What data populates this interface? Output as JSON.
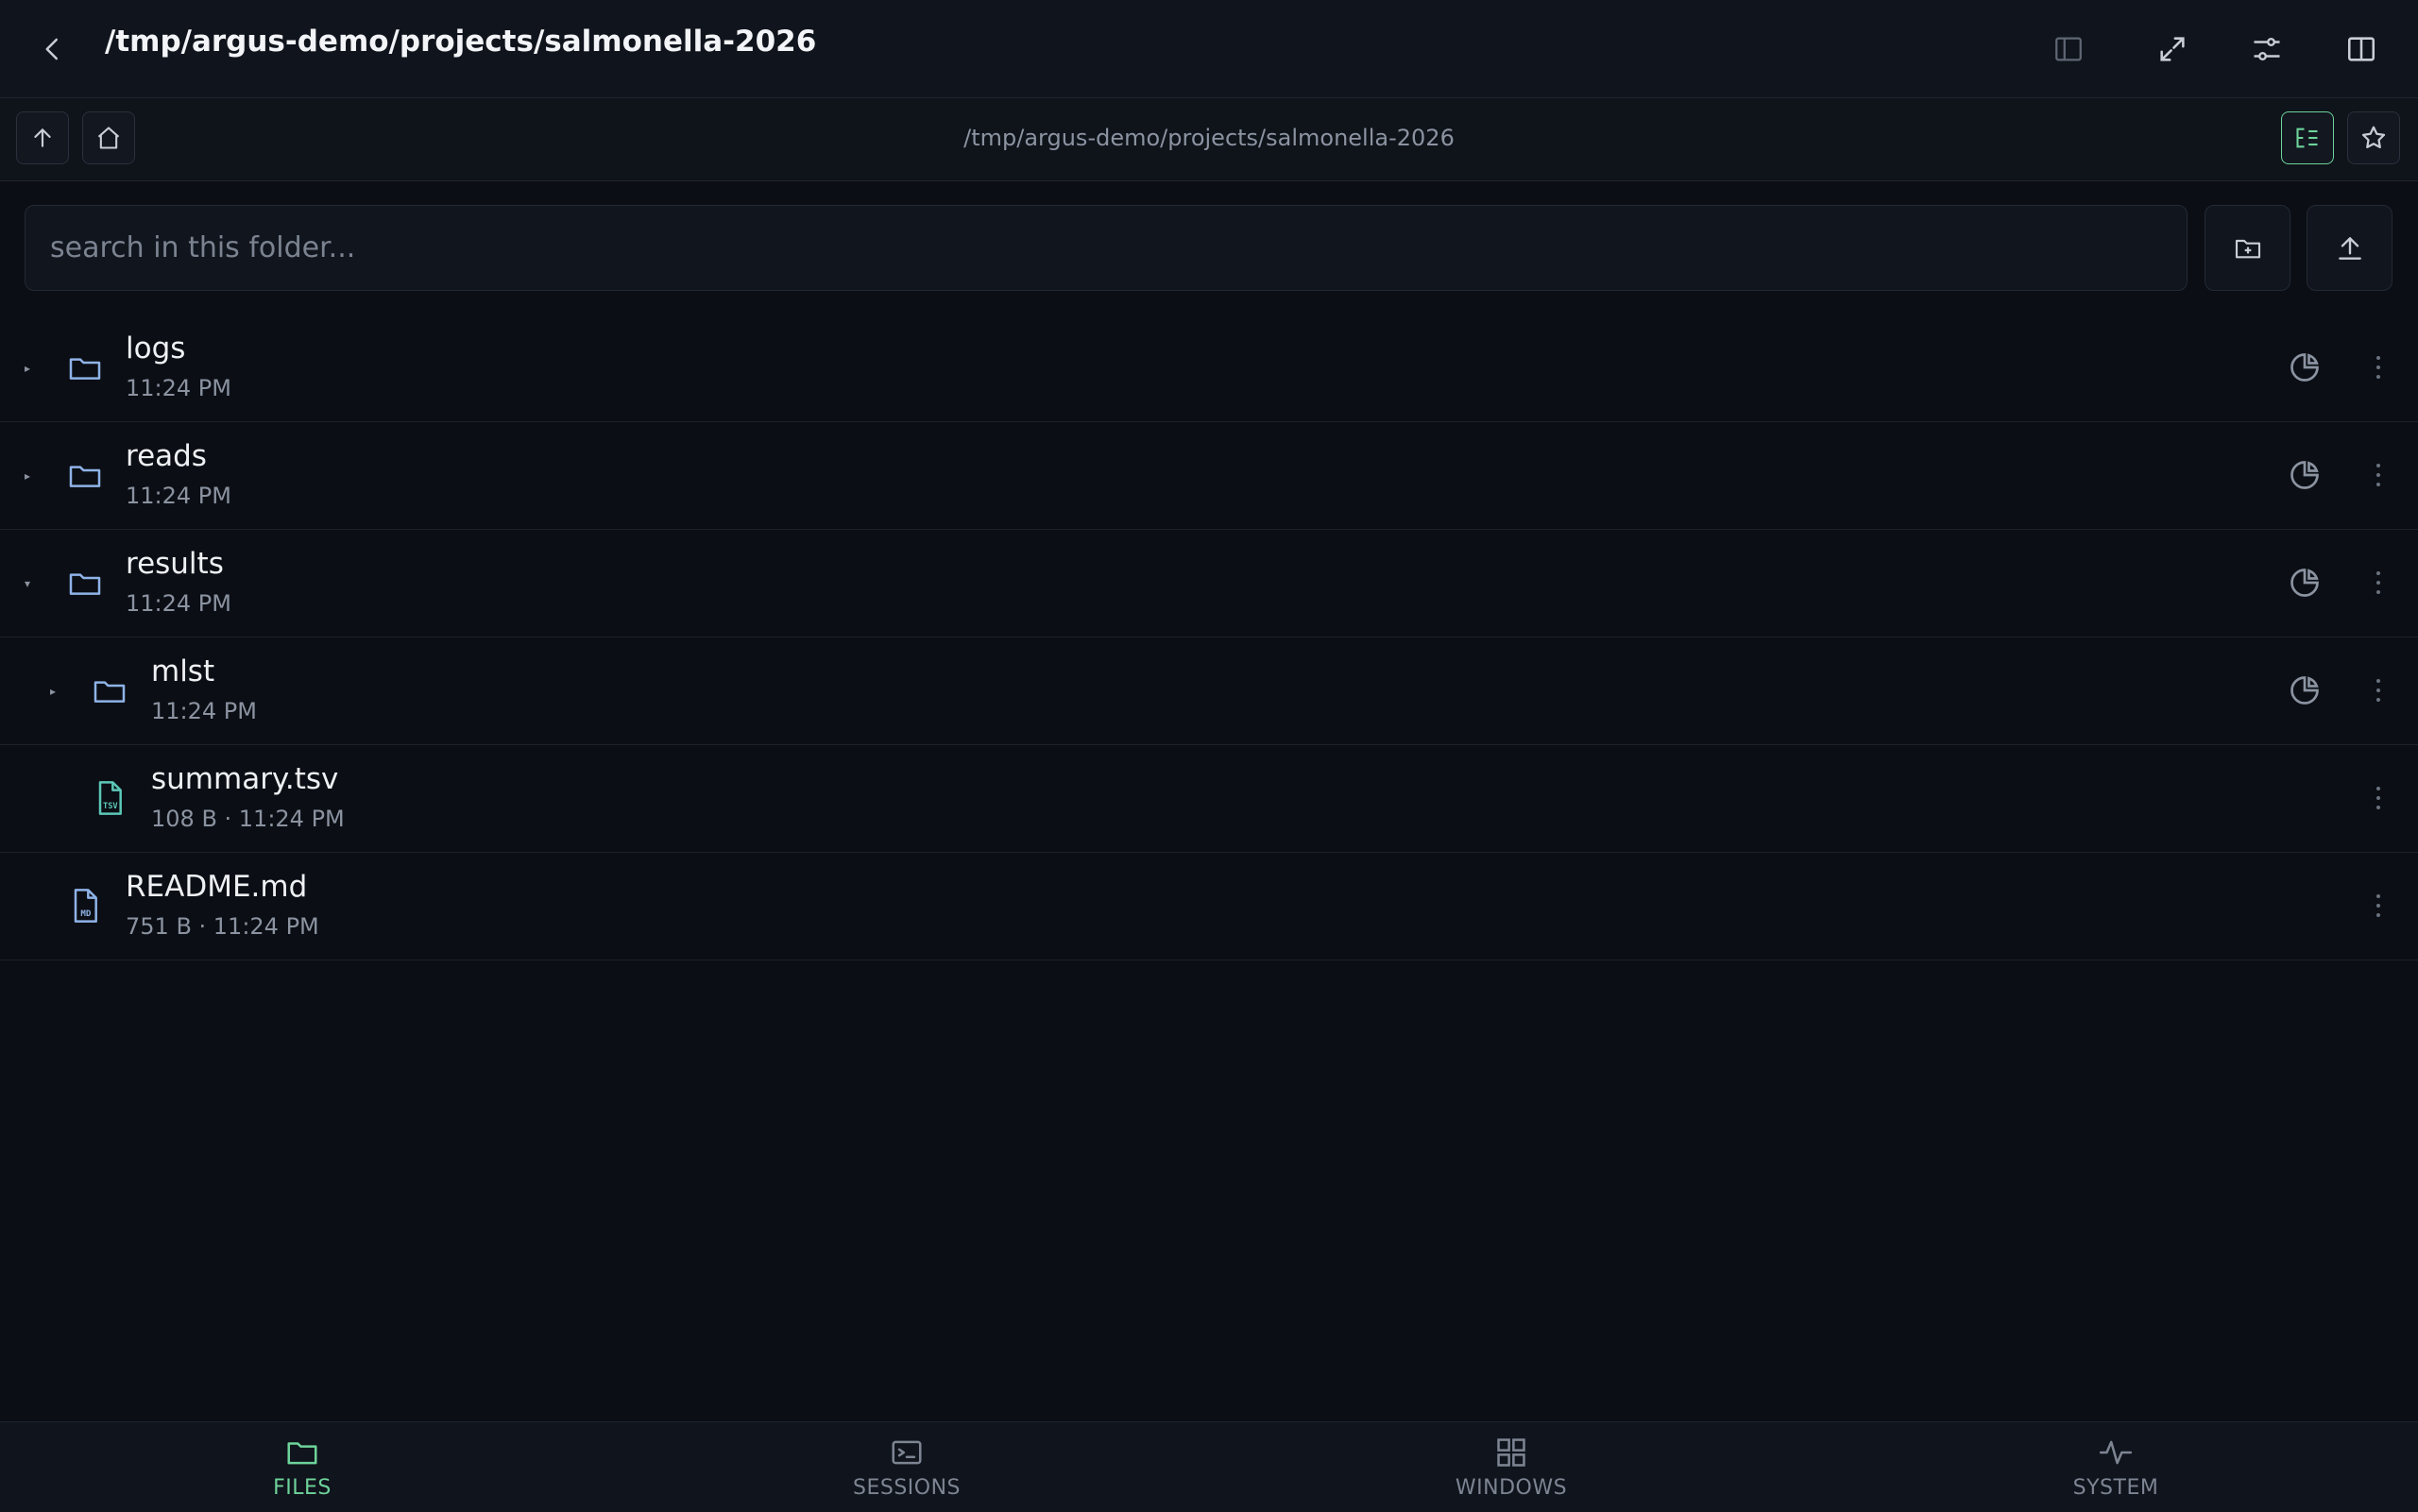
{
  "app": {
    "title": "/tmp/argus-demo/projects/salmonella-2026"
  },
  "toolbar": {
    "path": "/tmp/argus-demo/projects/salmonella-2026"
  },
  "search": {
    "placeholder": "search in this folder..."
  },
  "entries": [
    {
      "name": "logs",
      "meta": "11:24 PM",
      "kind": "folder",
      "expanded": false,
      "depth": 0
    },
    {
      "name": "reads",
      "meta": "11:24 PM",
      "kind": "folder",
      "expanded": false,
      "depth": 0
    },
    {
      "name": "results",
      "meta": "11:24 PM",
      "kind": "folder",
      "expanded": true,
      "depth": 0
    },
    {
      "name": "mlst",
      "meta": "11:24 PM",
      "kind": "folder",
      "expanded": false,
      "depth": 1
    },
    {
      "name": "summary.tsv",
      "meta": "108 B · 11:24 PM",
      "kind": "file",
      "badge": "TSV",
      "depth": 1
    },
    {
      "name": "README.md",
      "meta": "751 B · 11:24 PM",
      "kind": "file",
      "badge": "MD",
      "depth": 0
    }
  ],
  "nav": [
    {
      "label": "FILES",
      "icon": "folder-icon",
      "active": true
    },
    {
      "label": "SESSIONS",
      "icon": "terminal-icon",
      "active": false
    },
    {
      "label": "WINDOWS",
      "icon": "grid-icon",
      "active": false
    },
    {
      "label": "SYSTEM",
      "icon": "activity-icon",
      "active": false
    }
  ],
  "colors": {
    "background": "#0b0e14",
    "accent": "#6ed39a",
    "folder": "#8fb3e8",
    "tsv": "#5cc7b8"
  }
}
